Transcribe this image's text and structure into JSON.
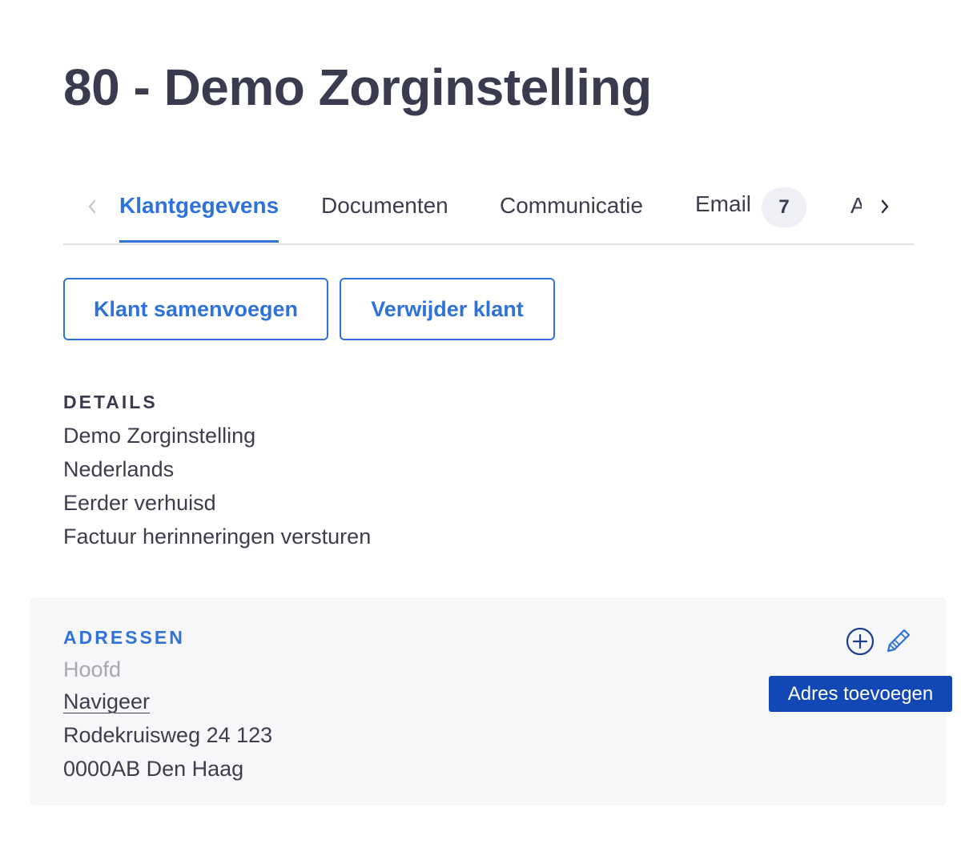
{
  "header": {
    "title": "80 - Demo Zorginstelling"
  },
  "tabs": {
    "items": [
      {
        "label": "Klantgegevens",
        "active": true
      },
      {
        "label": "Documenten",
        "active": false
      },
      {
        "label": "Communicatie",
        "active": false
      },
      {
        "label": "Email",
        "active": false,
        "badge": "7"
      }
    ],
    "clipped_label": "A"
  },
  "actions": {
    "merge_label": "Klant samenvoegen",
    "delete_label": "Verwijder klant"
  },
  "details": {
    "heading": "DETAILS",
    "lines": [
      "Demo Zorginstelling",
      "Nederlands",
      "Eerder verhuisd",
      "Factuur herinneringen versturen"
    ]
  },
  "addresses": {
    "heading": "ADRESSEN",
    "type": "Hoofd",
    "navigate_label": "Navigeer",
    "street": "Rodekruisweg 24 123",
    "postal_city": "0000AB Den Haag",
    "tooltip": "Adres toevoegen"
  },
  "colors": {
    "accent": "#2f73da",
    "tooltip_bg": "#1248b5",
    "icon": "#1b3f8f",
    "panel_bg": "#f7f7f9"
  },
  "icons": {
    "tabs_prev": "chevron-left-icon",
    "tabs_next": "chevron-right-icon",
    "add": "plus-circle-icon",
    "edit": "pencil-icon"
  }
}
